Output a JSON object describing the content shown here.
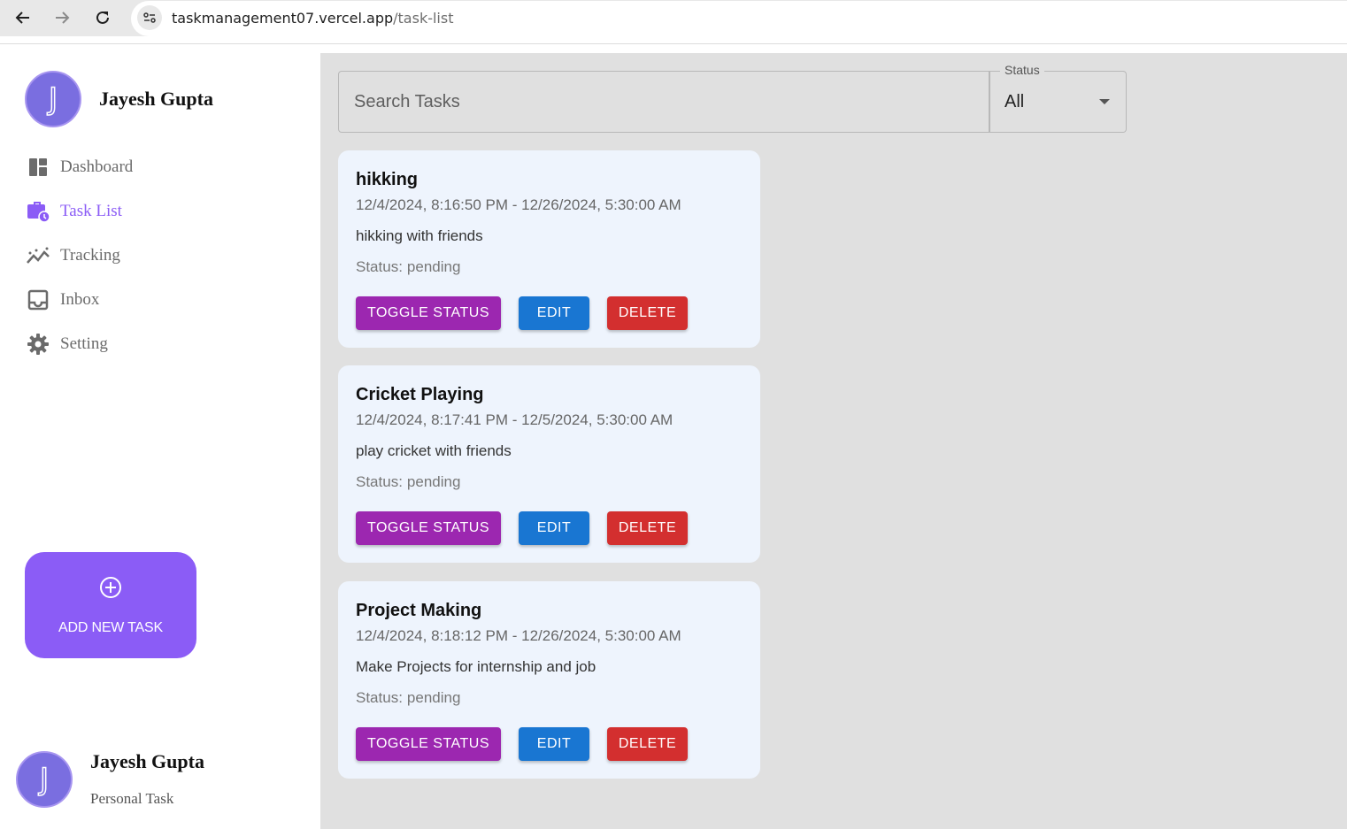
{
  "browser": {
    "url_domain": "taskmanagement07.vercel.app",
    "url_path": "/task-list"
  },
  "sidebar": {
    "profile": {
      "initial": "J",
      "name": "Jayesh Gupta"
    },
    "items": [
      {
        "label": "Dashboard",
        "icon": "dashboard-icon"
      },
      {
        "label": "Task List",
        "icon": "task-list-icon",
        "active": true
      },
      {
        "label": "Tracking",
        "icon": "tracking-icon"
      },
      {
        "label": "Inbox",
        "icon": "inbox-icon"
      },
      {
        "label": "Setting",
        "icon": "gear-icon"
      }
    ],
    "add_task_label": "ADD NEW TASK",
    "footer": {
      "initial": "J",
      "name": "Jayesh Gupta",
      "subtitle": "Personal Task"
    }
  },
  "search": {
    "placeholder": "Search Tasks",
    "value": ""
  },
  "filter": {
    "label": "Status",
    "value": "All"
  },
  "status_prefix": "Status:",
  "tasks": [
    {
      "title": "hikking",
      "dates": "12/4/2024, 8:16:50 PM - 12/26/2024, 5:30:00 AM",
      "description": "hikking with friends",
      "status": "pending"
    },
    {
      "title": "Cricket Playing",
      "dates": "12/4/2024, 8:17:41 PM - 12/5/2024, 5:30:00 AM",
      "description": "play cricket with friends",
      "status": "pending"
    },
    {
      "title": "Project Making",
      "dates": "12/4/2024, 8:18:12 PM - 12/26/2024, 5:30:00 AM",
      "description": "Make Projects for internship and job",
      "status": "pending"
    }
  ],
  "buttons": {
    "toggle": "TOGGLE STATUS",
    "edit": "EDIT",
    "delete": "DELETE"
  },
  "colors": {
    "accent": "#8b5cf6",
    "toggle": "#9c27b0",
    "edit": "#1976d2",
    "delete": "#d32f2f",
    "card_bg": "#eef4fd"
  }
}
